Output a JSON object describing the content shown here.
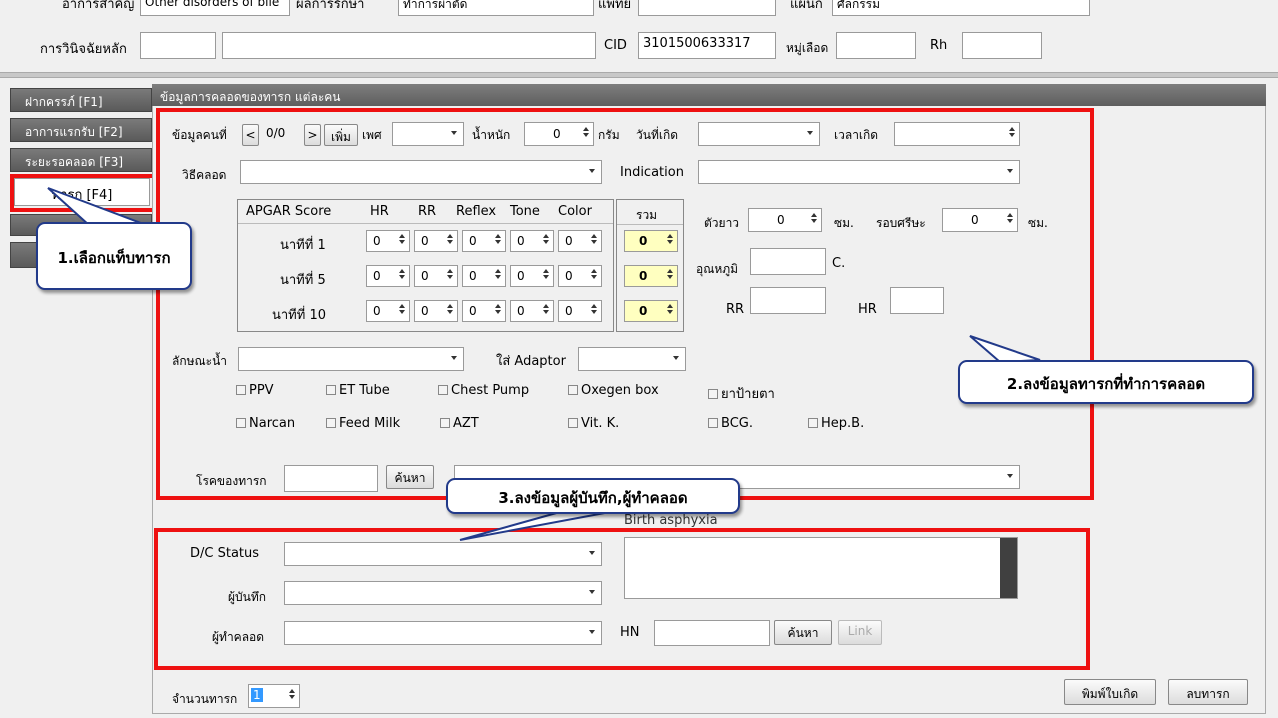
{
  "top": {
    "row1_label": "อาการสำคัญ",
    "row1_value": "Other disorders of bile",
    "row1_label2": "ผลการรักษา",
    "row1_value2": "ทำการผ่าตัด",
    "row1_label3": "แพทย์",
    "row1_label4": "แผนก",
    "row1_value4": "ศัลกรรม",
    "diag_label": "การวินิจฉัยหลัก",
    "cid_label": "CID",
    "cid_value": "3101500633317",
    "blood_label": "หมู่เลือด",
    "rh_label": "Rh"
  },
  "tabs": [
    "ฝากครรภ์ [F1]",
    "อาการแรกรับ [F2]",
    "ระยะรอคลอด [F3]",
    "ทารก [F4]"
  ],
  "panel_title": "ข้อมูลการคลอดของทารก แต่ละคน",
  "baby": {
    "record_label": "ข้อมูลคนที่",
    "nav_prev": "<",
    "record_counter": "0/0",
    "nav_next": ">",
    "add_label": "เพิ่ม",
    "sex_label": "เพศ",
    "weight_label": "น้ำหนัก",
    "weight_value": "0",
    "gram_label": "กรัม",
    "birthdate_label": "วันที่เกิด",
    "birthtime_label": "เวลาเกิด",
    "method_label": "วิธีคลอด",
    "indication_label": "Indication"
  },
  "apgar": {
    "headers": [
      "APGAR Score",
      "HR",
      "RR",
      "Reflex",
      "Tone",
      "Color"
    ],
    "total_header": "รวม",
    "rows": [
      {
        "label": "นาทีที่ 1",
        "values": [
          "0",
          "0",
          "0",
          "0",
          "0"
        ],
        "total": "0"
      },
      {
        "label": "นาทีที่ 5",
        "values": [
          "0",
          "0",
          "0",
          "0",
          "0"
        ],
        "total": "0"
      },
      {
        "label": "นาทีที่ 10",
        "values": [
          "0",
          "0",
          "0",
          "0",
          "0"
        ],
        "total": "0"
      }
    ]
  },
  "vitals": {
    "length_label": "ตัวยาว",
    "length_value": "0",
    "cm1": "ซม.",
    "head_label": "รอบศรีษะ",
    "head_value": "0",
    "cm2": "ซม.",
    "temp_label": "อุณหภูมิ",
    "temp_unit": "C.",
    "rr_label": "RR",
    "hr_label": "HR"
  },
  "fluid_label": "ลักษณะน้ำ",
  "adaptor_label": "ใส่ Adaptor",
  "checkboxes_row1": [
    "PPV",
    "ET Tube",
    "Chest Pump",
    "Oxegen box",
    "ยาป้ายตา"
  ],
  "checkboxes_row2": [
    "Narcan",
    "Feed Milk",
    "AZT",
    "Vit. K.",
    "BCG.",
    "Hep.B."
  ],
  "disease_label": "โรคของทารก",
  "search_label": "ค้นหา",
  "lower": {
    "birth_asphyxia": "Birth asphyxia",
    "dc_label": "D/C Status",
    "recorder_label": "ผู้บันทึก",
    "deliverer_label": "ผู้ทำคลอด",
    "hn_label": "HN",
    "search_label": "ค้นหา",
    "link_label": "Link"
  },
  "footer": {
    "count_label": "จำนวนทารก",
    "count_value": "1",
    "print_label": "พิมพ์ใบเกิด",
    "delete_label": "ลบทารก"
  },
  "callouts": {
    "c1": "1.เลือกแท็บทารก",
    "c2": "2.ลงข้อมูลทารกที่ทำการคลอด",
    "c3": "3.ลงข้อมูลผู้บันทึก,ผู้ทำคลอด"
  },
  "colors": {
    "highlight": "#ee1111",
    "callout_border": "#223a8a",
    "panel_header": "#6e6e6e",
    "total_field": "#ffffc0"
  }
}
